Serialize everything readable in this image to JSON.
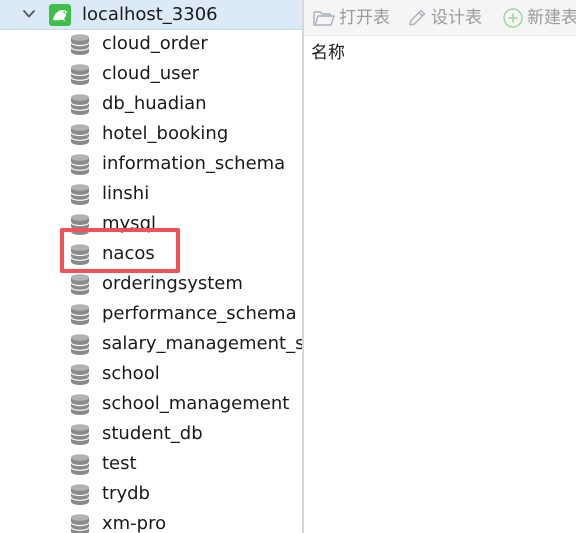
{
  "connection": {
    "label": "localhost_3306",
    "icon": "dolphin-connection-icon",
    "expanded": true,
    "icon_color": "#3cc04a"
  },
  "databases": [
    {
      "label": "cloud_order"
    },
    {
      "label": "cloud_user"
    },
    {
      "label": "db_huadian"
    },
    {
      "label": "hotel_booking"
    },
    {
      "label": "information_schema"
    },
    {
      "label": "linshi"
    },
    {
      "label": "mysql"
    },
    {
      "label": "nacos"
    },
    {
      "label": "orderingsystem"
    },
    {
      "label": "performance_schema"
    },
    {
      "label": "salary_management_sy"
    },
    {
      "label": "school"
    },
    {
      "label": "school_management"
    },
    {
      "label": "student_db"
    },
    {
      "label": "test"
    },
    {
      "label": "trydb"
    },
    {
      "label": "xm-pro"
    }
  ],
  "highlighted_database": "nacos",
  "toolbar": {
    "open_table": "打开表",
    "design_table": "设计表",
    "new_table": "新建表"
  },
  "table_list": {
    "column_header": "名称"
  },
  "colors": {
    "selection_bg": "#dceaf7",
    "highlight_border": "#f0525a",
    "disabled_text": "#9b9b9b"
  }
}
